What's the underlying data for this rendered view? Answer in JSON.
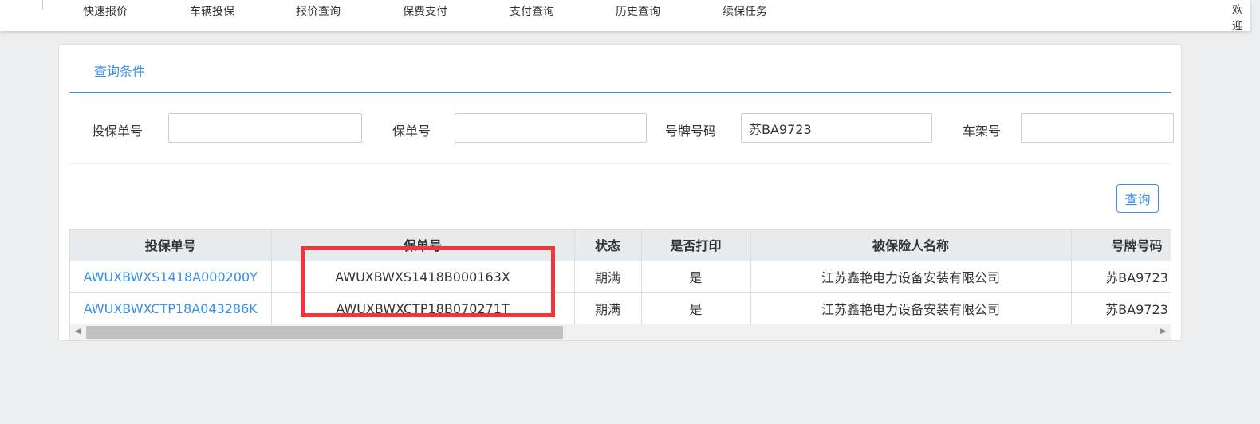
{
  "nav": {
    "items": [
      "快速报价",
      "车辆投保",
      "报价查询",
      "保费支付",
      "支付查询",
      "历史查询",
      "续保任务"
    ],
    "welcome": "欢迎"
  },
  "tab": "查询条件",
  "form": {
    "proposal_no_label": "投保单号",
    "proposal_no_value": "",
    "policy_no_label": "保单号",
    "policy_no_value": "",
    "plate_label": "号牌号码",
    "plate_value": "苏BA9723",
    "vin_label": "车架号",
    "vin_value": ""
  },
  "query_button": "查询",
  "table": {
    "headers": [
      "投保单号",
      "保单号",
      "状态",
      "是否打印",
      "被保险人名称",
      "号牌号码"
    ],
    "rows": [
      [
        "AWUXBWXS1418A000200Y",
        "AWUXBWXS1418B000163X",
        "期满",
        "是",
        "江苏鑫艳电力设备安装有限公司",
        "苏BA9723"
      ],
      [
        "AWUXBWXCTP18A043286K",
        "AWUXBWXCTP18B070271T",
        "期满",
        "是",
        "江苏鑫艳电力设备安装有限公司",
        "苏BA9723"
      ]
    ]
  },
  "colors": {
    "accent": "#3a8ee6",
    "highlight": "#f3343a"
  }
}
